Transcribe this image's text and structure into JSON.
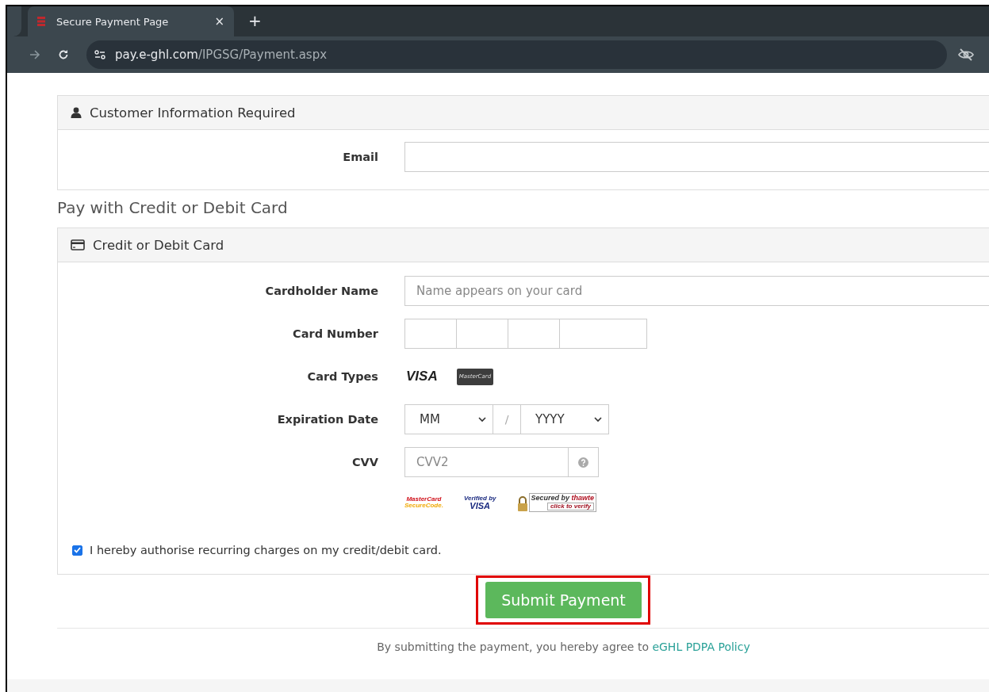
{
  "browser": {
    "tab": {
      "title": "Secure Payment Page",
      "close": "×",
      "selected": true
    },
    "new_tab": "+",
    "url": {
      "host": "pay.e-ghl.com",
      "path": "/IPGSG/Payment.aspx"
    }
  },
  "customer_panel": {
    "title": "Customer Information Required",
    "fields": [
      {
        "label": "Email"
      }
    ]
  },
  "section_title": "Pay with Credit or Debit Card",
  "card_panel": {
    "title": "Credit or Debit Card",
    "cardholder": {
      "label": "Cardholder Name",
      "placeholder": "Name appears on your card"
    },
    "card_number": {
      "label": "Card Number"
    },
    "card_types": {
      "label": "Card Types",
      "logos": [
        {
          "kind": "visa",
          "text": "VISA"
        },
        {
          "kind": "mastercard",
          "text": "MasterCard"
        }
      ]
    },
    "expiration": {
      "label": "Expiration Date",
      "month": "MM",
      "separator": "/",
      "year": "YYYY"
    },
    "cvv": {
      "label": "CVV",
      "placeholder": "CVV2"
    },
    "security_badges": [
      {
        "kind": "securecode",
        "lines": [
          "MasterCard",
          "SecureCode."
        ]
      },
      {
        "kind": "verified",
        "lines": [
          "Verified by",
          "VISA"
        ]
      },
      {
        "kind": "thawte",
        "lines": [
          "Secured by",
          "thawte",
          "click to verify"
        ]
      }
    ],
    "consent": {
      "label": "I hereby authorise recurring charges on my credit/debit card.",
      "checked": true
    }
  },
  "submit": {
    "label": "Submit Payment",
    "highlighted": true
  },
  "footer": {
    "text": "By submitting the payment, you hereby agree to",
    "link": "eGHL PDPA Policy"
  }
}
